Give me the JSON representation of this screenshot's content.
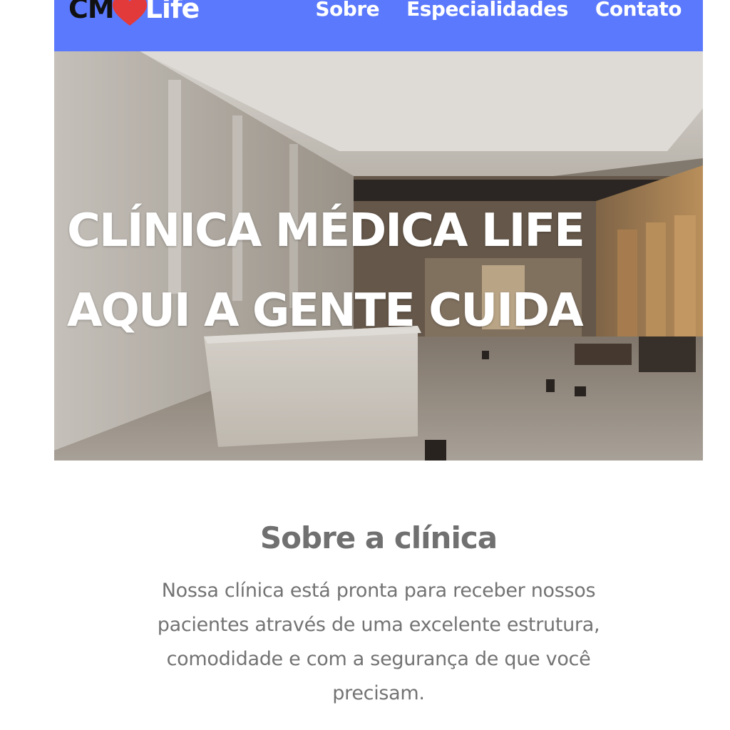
{
  "navbar": {
    "logo": {
      "left_text": "CM",
      "right_text": "Life",
      "heart_icon": "heart-icon",
      "heart_color": "#e23a3a"
    },
    "links": [
      {
        "label": "Sobre"
      },
      {
        "label": "Especialidades"
      },
      {
        "label": "Contato"
      }
    ],
    "background_color": "#5b79fc"
  },
  "hero": {
    "image": "clinic-lobby-image",
    "title_line1": "CLÍNICA MÉDICA LIFE",
    "title_line2": "AQUI A GENTE CUIDA"
  },
  "about": {
    "title": "Sobre a clínica",
    "text": "Nossa clínica está pronta para receber nossos pacientes através de uma excelente estrutura, comodidade e com a segurança de que você precisam."
  }
}
